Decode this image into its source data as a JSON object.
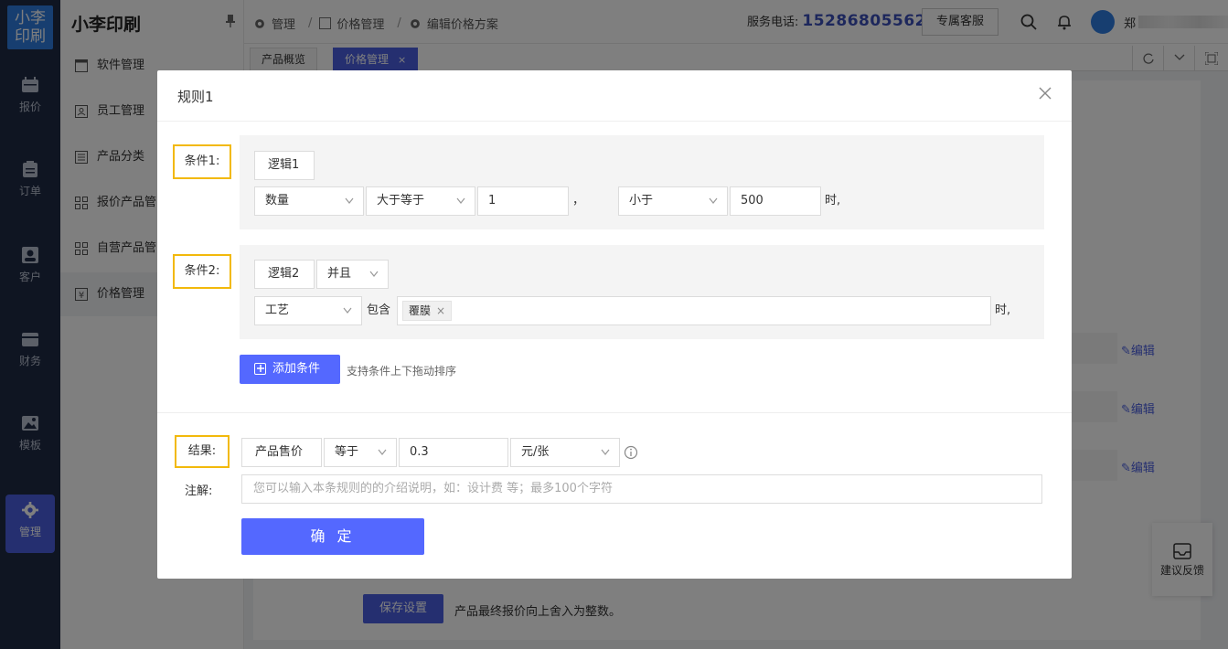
{
  "app": {
    "logo_line1": "小李",
    "logo_line2": "印刷",
    "title": "小李印刷"
  },
  "rail": [
    {
      "label": "报价",
      "icon": "calendar-icon"
    },
    {
      "label": "订单",
      "icon": "clipboard-icon"
    },
    {
      "label": "客户",
      "icon": "contact-icon"
    },
    {
      "label": "财务",
      "icon": "wallet-icon"
    },
    {
      "label": "模板",
      "icon": "image-icon"
    },
    {
      "label": "管理",
      "icon": "gear-icon"
    }
  ],
  "sidebar": [
    {
      "label": "软件管理"
    },
    {
      "label": "员工管理"
    },
    {
      "label": "产品分类"
    },
    {
      "label": "报价产品管"
    },
    {
      "label": "自营产品管"
    },
    {
      "label": "价格管理"
    }
  ],
  "breadcrumb": [
    "管理",
    "价格管理",
    "编辑价格方案"
  ],
  "header": {
    "service_label": "服务电话:",
    "service_phone": "15286805562",
    "vip_label": "专属客服",
    "user_initial": "郑"
  },
  "tabs": [
    {
      "label": "产品概览"
    },
    {
      "label": "价格管理",
      "close": "×"
    }
  ],
  "background": {
    "edit_label": "编辑",
    "save_label": "保存设置",
    "save_note": "产品最终报价向上舍入为整数。",
    "feedback_label": "建议反馈"
  },
  "modal": {
    "title": "规则1",
    "condition1": {
      "label": "条件1:",
      "logic": "逻辑1",
      "field": "数量",
      "op1": "大于等于",
      "val1": "1",
      "comma": "，",
      "op2": "小于",
      "val2": "500",
      "suffix": "时,"
    },
    "condition2": {
      "label": "条件2:",
      "logic": "逻辑2",
      "join": "并且",
      "field": "工艺",
      "contains": "包含",
      "chip": "覆膜",
      "chip_close": "×",
      "suffix": "时,"
    },
    "add_condition": "添加条件",
    "add_note": "支持条件上下拖动排序",
    "result": {
      "label": "结果:",
      "target": "产品售价",
      "op": "等于",
      "value": "0.3",
      "unit": "元/张"
    },
    "note_label": "注解:",
    "note_placeholder": "您可以输入本条规则的的介绍说明，如：设计费 等；最多100个字符",
    "confirm": "确 定"
  }
}
